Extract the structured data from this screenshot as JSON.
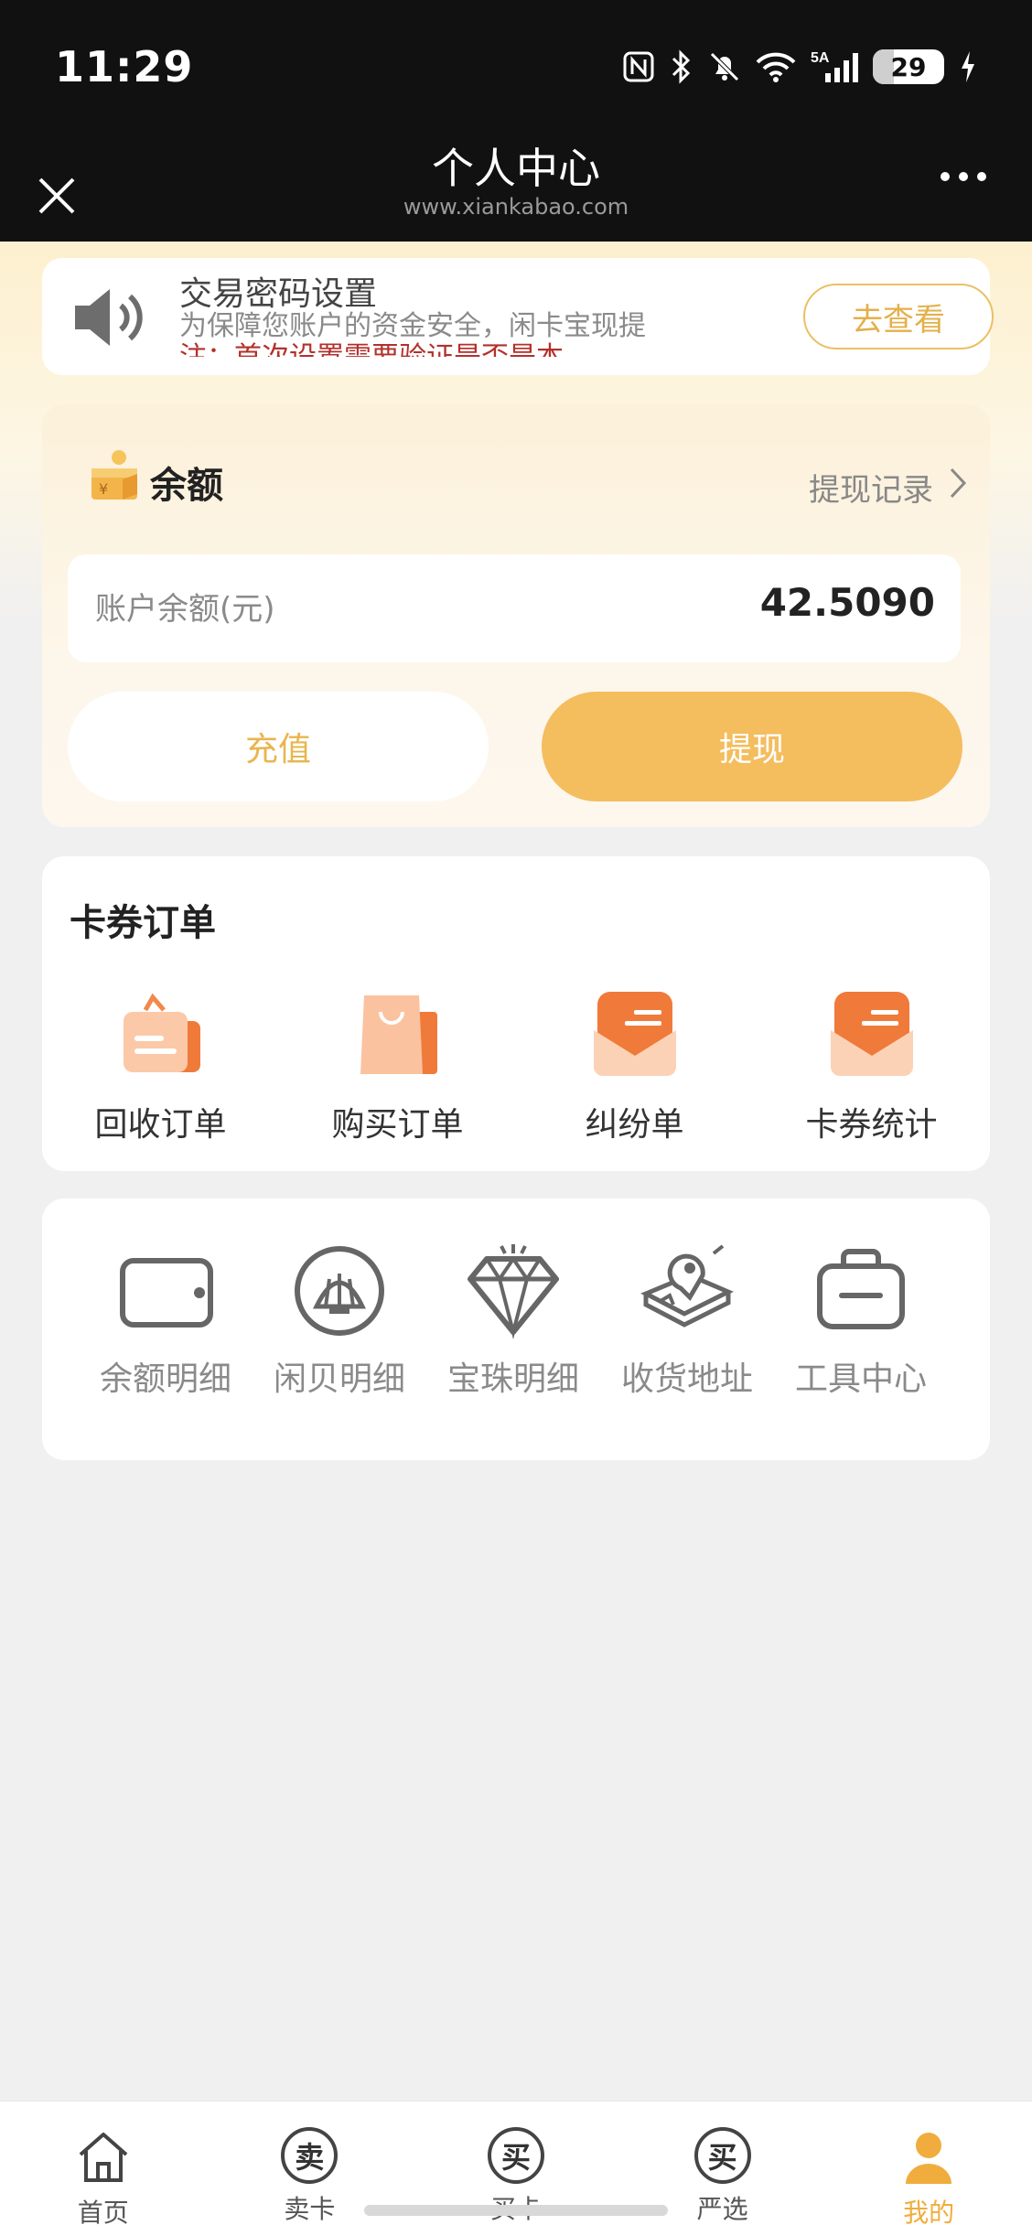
{
  "status_bar": {
    "time": "11:29",
    "battery": "29",
    "network": "5A"
  },
  "nav": {
    "title": "个人中心",
    "url": "www.xiankabao.com"
  },
  "notice": {
    "title": "交易密码设置",
    "line1": "为保障您账户的资金安全，闲卡宝现提",
    "line2": "注：首次设置需要验证是否是本",
    "button": "去查看"
  },
  "balance": {
    "title": "余额",
    "record_link": "提现记录",
    "account_label": "账户余额(元)",
    "account_value": "42.5090",
    "recharge_button": "充值",
    "withdraw_button": "提现"
  },
  "orders": {
    "title": "卡券订单",
    "items": [
      {
        "label": "回收订单",
        "icon": "recycle-order-icon"
      },
      {
        "label": "购买订单",
        "icon": "shopping-bag-icon"
      },
      {
        "label": "纠纷单",
        "icon": "dispute-envelope-icon"
      },
      {
        "label": "卡券统计",
        "icon": "stats-envelope-icon"
      }
    ]
  },
  "tools": {
    "items": [
      {
        "label": "余额明细",
        "icon": "wallet-icon"
      },
      {
        "label": "闲贝明细",
        "icon": "shell-icon"
      },
      {
        "label": "宝珠明细",
        "icon": "diamond-icon"
      },
      {
        "label": "收货地址",
        "icon": "address-map-icon"
      },
      {
        "label": "工具中心",
        "icon": "toolbox-icon"
      }
    ]
  },
  "tab_bar": {
    "tabs": [
      {
        "label": "首页",
        "icon": "home-icon",
        "glyph": ""
      },
      {
        "label": "卖卡",
        "icon": "sell-seal-icon",
        "glyph": "卖"
      },
      {
        "label": "买卡",
        "icon": "buy-seal-icon",
        "glyph": "买"
      },
      {
        "label": "严选",
        "icon": "select-seal-icon",
        "glyph": "买"
      },
      {
        "label": "我的",
        "icon": "user-icon",
        "glyph": ""
      }
    ],
    "active_index": 4,
    "accent": "#f0ad3d"
  },
  "colors": {
    "accent": "#f4bd5e",
    "notice_red": "#b3302b"
  }
}
